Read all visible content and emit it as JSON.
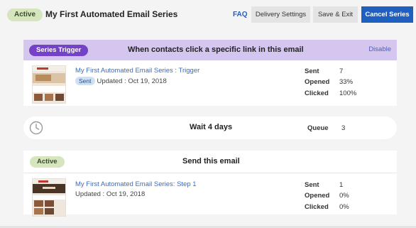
{
  "header": {
    "status_badge": "Active",
    "title": "My First Automated Email Series",
    "faq_label": "FAQ",
    "delivery_settings_label": "Delivery Settings",
    "save_exit_label": "Save & Exit",
    "cancel_series_label": "Cancel Series"
  },
  "trigger": {
    "badge": "Series Trigger",
    "description": "When contacts click a specific link in this email",
    "disable_label": "Disable",
    "email_name": "My First Automated Email Series : Trigger",
    "status_tag": "Sent",
    "updated": "Updated : Oct 19, 2018",
    "stats": [
      {
        "label": "Sent",
        "value": "7"
      },
      {
        "label": "Opened",
        "value": "33%"
      },
      {
        "label": "Clicked",
        "value": "100%"
      }
    ]
  },
  "wait": {
    "icon": "clock-icon",
    "text": "Wait 4 days",
    "queue_label": "Queue",
    "queue_value": "3"
  },
  "step": {
    "badge": "Active",
    "title": "Send this email",
    "email_name": "My First Automated Email Series: Step 1",
    "updated": "Updated : Oct 19, 2018",
    "stats": [
      {
        "label": "Sent",
        "value": "1"
      },
      {
        "label": "Opened",
        "value": "0%"
      },
      {
        "label": "Clicked",
        "value": "0%"
      }
    ]
  },
  "colors": {
    "active_badge": "#d5e6bf",
    "trigger_header": "#d4c6ef",
    "trigger_pill": "#7442c6",
    "primary_button": "#1f5fbf",
    "link": "#3c6bc0"
  }
}
